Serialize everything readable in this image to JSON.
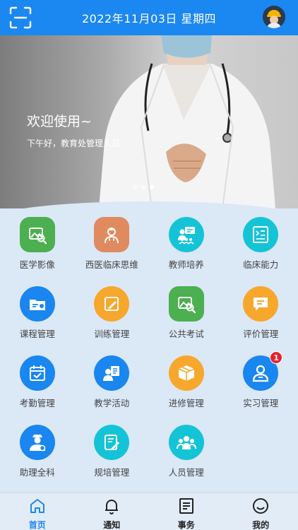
{
  "header": {
    "date": "2022年11月03日 星期四"
  },
  "banner": {
    "title": "欢迎使用~",
    "greeting": "下午好，教育处管理人员",
    "dots": [
      false,
      false,
      true
    ]
  },
  "grid": [
    {
      "label": "医学影像",
      "icon": "image-search-icon",
      "color": "#4caf50",
      "shape": "rounded"
    },
    {
      "label": "西医临床思维",
      "icon": "doctor-icon",
      "color": "#e08a60",
      "shape": "rounded"
    },
    {
      "label": "教师培养",
      "icon": "teacher-icon",
      "color": "#14c4d6",
      "shape": "circle"
    },
    {
      "label": "临床能力",
      "icon": "clinical-skill-icon",
      "color": "#14c4d6",
      "shape": "circle"
    },
    {
      "label": "课程管理",
      "icon": "course-folder-icon",
      "color": "#1a86ef",
      "shape": "circle"
    },
    {
      "label": "训练管理",
      "icon": "training-edit-icon",
      "color": "#f7a72c",
      "shape": "circle"
    },
    {
      "label": "公共考试",
      "icon": "exam-image-icon",
      "color": "#4caf50",
      "shape": "rounded"
    },
    {
      "label": "评价管理",
      "icon": "comment-icon",
      "color": "#f7a72c",
      "shape": "circle"
    },
    {
      "label": "考勤管理",
      "icon": "calendar-check-icon",
      "color": "#1a86ef",
      "shape": "circle"
    },
    {
      "label": "教学活动",
      "icon": "teaching-activity-icon",
      "color": "#1a86ef",
      "shape": "circle"
    },
    {
      "label": "进修管理",
      "icon": "package-icon",
      "color": "#f7a72c",
      "shape": "circle"
    },
    {
      "label": "实习管理",
      "icon": "intern-user-icon",
      "color": "#1a86ef",
      "shape": "circle",
      "badge": "1"
    },
    {
      "label": "助理全科",
      "icon": "assistant-doctor-icon",
      "color": "#1a86ef",
      "shape": "circle"
    },
    {
      "label": "规培管理",
      "icon": "standard-training-icon",
      "color": "#14c4d6",
      "shape": "circle"
    },
    {
      "label": "人员管理",
      "icon": "people-group-icon",
      "color": "#14c4d6",
      "shape": "circle"
    }
  ],
  "nav": [
    {
      "label": "首页",
      "icon": "home-icon",
      "active": true
    },
    {
      "label": "通知",
      "icon": "bell-icon",
      "active": false
    },
    {
      "label": "事务",
      "icon": "document-icon",
      "active": false
    },
    {
      "label": "我的",
      "icon": "profile-icon",
      "active": false
    }
  ],
  "colors": {
    "primary": "#1b87f0",
    "badge": "#e8202b",
    "background": "#dbe8f6"
  }
}
